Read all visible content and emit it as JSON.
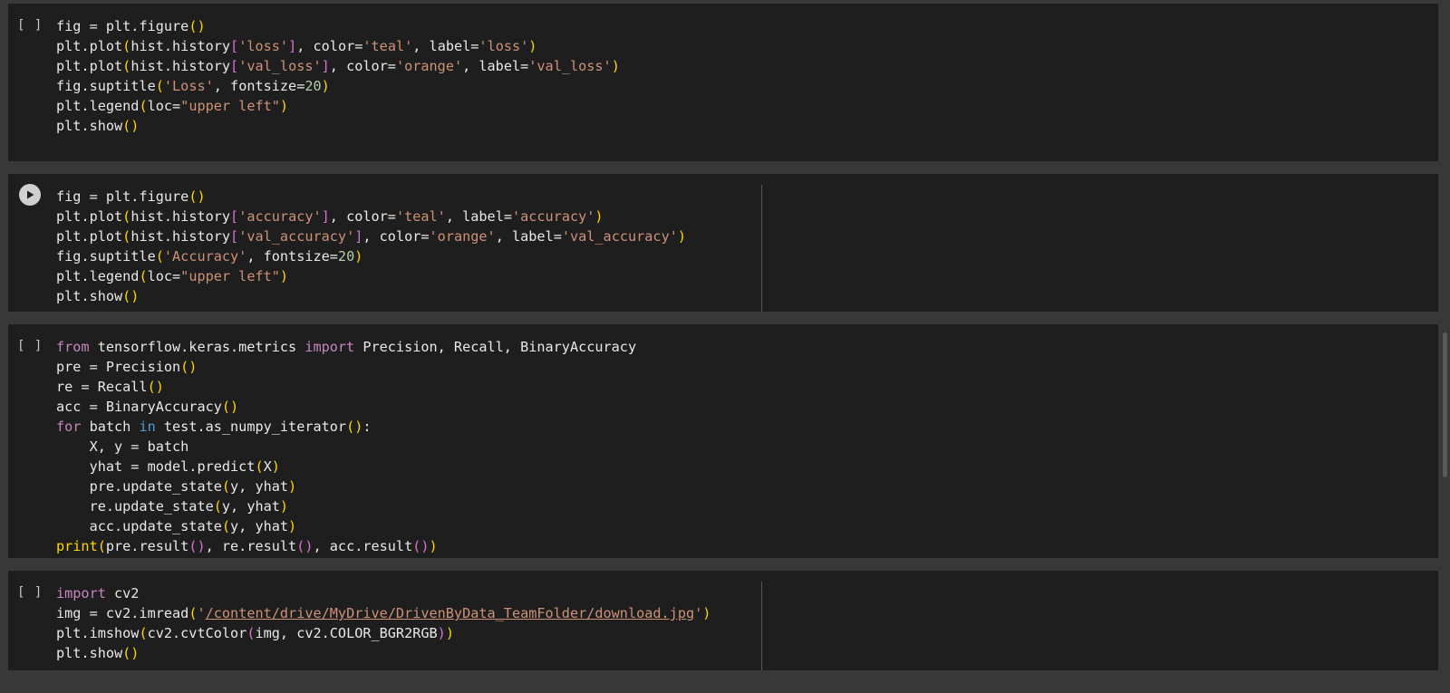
{
  "cells": [
    {
      "gutter": "[ ]",
      "lines": [
        [
          {
            "t": "fig = plt.figure"
          },
          {
            "t": "()",
            "c": "p"
          }
        ],
        [
          {
            "t": "plt.plot"
          },
          {
            "t": "(",
            "c": "p"
          },
          {
            "t": "hist.history"
          },
          {
            "t": "[",
            "c": "pp"
          },
          {
            "t": "'loss'",
            "c": "s"
          },
          {
            "t": "]",
            "c": "pp"
          },
          {
            "t": ", color="
          },
          {
            "t": "'teal'",
            "c": "s"
          },
          {
            "t": ", label="
          },
          {
            "t": "'loss'",
            "c": "s"
          },
          {
            "t": ")",
            "c": "p"
          }
        ],
        [
          {
            "t": "plt.plot"
          },
          {
            "t": "(",
            "c": "p"
          },
          {
            "t": "hist.history"
          },
          {
            "t": "[",
            "c": "pp"
          },
          {
            "t": "'val_loss'",
            "c": "s"
          },
          {
            "t": "]",
            "c": "pp"
          },
          {
            "t": ", color="
          },
          {
            "t": "'orange'",
            "c": "s"
          },
          {
            "t": ", label="
          },
          {
            "t": "'val_loss'",
            "c": "s"
          },
          {
            "t": ")",
            "c": "p"
          }
        ],
        [
          {
            "t": "fig.suptitle"
          },
          {
            "t": "(",
            "c": "p"
          },
          {
            "t": "'Loss'",
            "c": "s"
          },
          {
            "t": ", fontsize="
          },
          {
            "t": "20",
            "c": "n"
          },
          {
            "t": ")",
            "c": "p"
          }
        ],
        [
          {
            "t": "plt.legend"
          },
          {
            "t": "(",
            "c": "p"
          },
          {
            "t": "loc="
          },
          {
            "t": "\"upper left\"",
            "c": "s"
          },
          {
            "t": ")",
            "c": "p"
          }
        ],
        [
          {
            "t": "plt.show"
          },
          {
            "t": "()",
            "c": "p"
          }
        ]
      ]
    },
    {
      "gutter": "",
      "lines": [
        [
          {
            "t": "fig = plt.figure"
          },
          {
            "t": "()",
            "c": "p"
          }
        ],
        [
          {
            "t": "plt.plot"
          },
          {
            "t": "(",
            "c": "p"
          },
          {
            "t": "hist.history"
          },
          {
            "t": "[",
            "c": "pp"
          },
          {
            "t": "'accuracy'",
            "c": "s"
          },
          {
            "t": "]",
            "c": "pp"
          },
          {
            "t": ", color="
          },
          {
            "t": "'teal'",
            "c": "s"
          },
          {
            "t": ", label="
          },
          {
            "t": "'accuracy'",
            "c": "s"
          },
          {
            "t": ")",
            "c": "p"
          }
        ],
        [
          {
            "t": "plt.plot"
          },
          {
            "t": "(",
            "c": "p"
          },
          {
            "t": "hist.history"
          },
          {
            "t": "[",
            "c": "pp"
          },
          {
            "t": "'val_accuracy'",
            "c": "s"
          },
          {
            "t": "]",
            "c": "pp"
          },
          {
            "t": ", color="
          },
          {
            "t": "'orange'",
            "c": "s"
          },
          {
            "t": ", label="
          },
          {
            "t": "'val_accuracy'",
            "c": "s"
          },
          {
            "t": ")",
            "c": "p"
          }
        ],
        [
          {
            "t": "fig.suptitle"
          },
          {
            "t": "(",
            "c": "p"
          },
          {
            "t": "'Accuracy'",
            "c": "s"
          },
          {
            "t": ", fontsize="
          },
          {
            "t": "20",
            "c": "n"
          },
          {
            "t": ")",
            "c": "p"
          }
        ],
        [
          {
            "t": "plt.legend"
          },
          {
            "t": "(",
            "c": "p"
          },
          {
            "t": "loc="
          },
          {
            "t": "\"upper left\"",
            "c": "s"
          },
          {
            "t": ")",
            "c": "p"
          }
        ],
        [
          {
            "t": "plt.show"
          },
          {
            "t": "()",
            "c": "p"
          }
        ]
      ]
    },
    {
      "gutter": "[ ]",
      "lines": [
        [
          {
            "t": "from",
            "c": "k"
          },
          {
            "t": " tensorflow.keras.metrics "
          },
          {
            "t": "import",
            "c": "k"
          },
          {
            "t": " Precision, Recall, BinaryAccuracy"
          }
        ],
        [
          {
            "t": "pre = Precision"
          },
          {
            "t": "()",
            "c": "p"
          }
        ],
        [
          {
            "t": "re = Recall"
          },
          {
            "t": "()",
            "c": "p"
          }
        ],
        [
          {
            "t": "acc = BinaryAccuracy"
          },
          {
            "t": "()",
            "c": "p"
          }
        ],
        [
          {
            "t": "for",
            "c": "k"
          },
          {
            "t": " batch "
          },
          {
            "t": "in",
            "c": "kb"
          },
          {
            "t": " test.as_numpy_iterator"
          },
          {
            "t": "()",
            "c": "p"
          },
          {
            "t": ":"
          }
        ],
        [
          {
            "t": "    X, y = batch"
          }
        ],
        [
          {
            "t": "    yhat = model.predict"
          },
          {
            "t": "(",
            "c": "p"
          },
          {
            "t": "X"
          },
          {
            "t": ")",
            "c": "p"
          }
        ],
        [
          {
            "t": "    pre.update_state"
          },
          {
            "t": "(",
            "c": "p"
          },
          {
            "t": "y, yhat"
          },
          {
            "t": ")",
            "c": "p"
          }
        ],
        [
          {
            "t": "    re.update_state"
          },
          {
            "t": "(",
            "c": "p"
          },
          {
            "t": "y, yhat"
          },
          {
            "t": ")",
            "c": "p"
          }
        ],
        [
          {
            "t": "    acc.update_state"
          },
          {
            "t": "(",
            "c": "p"
          },
          {
            "t": "y, yhat"
          },
          {
            "t": ")",
            "c": "p"
          }
        ],
        [
          {
            "t": "print",
            "c": "p"
          },
          {
            "t": "(",
            "c": "p"
          },
          {
            "t": "pre.result"
          },
          {
            "t": "()",
            "c": "pp"
          },
          {
            "t": ", re.result"
          },
          {
            "t": "()",
            "c": "pp"
          },
          {
            "t": ", acc.result"
          },
          {
            "t": "()",
            "c": "pp"
          },
          {
            "t": ")",
            "c": "p"
          }
        ]
      ]
    },
    {
      "gutter": "[ ]",
      "lines": [
        [
          {
            "t": "import",
            "c": "k"
          },
          {
            "t": " cv2"
          }
        ],
        [
          {
            "t": "img = cv2.imread"
          },
          {
            "t": "(",
            "c": "p"
          },
          {
            "t": "'",
            "c": "s"
          },
          {
            "t": "/content/drive/MyDrive/DrivenByData_TeamFolder/download.jpg",
            "c": "s u"
          },
          {
            "t": "'",
            "c": "s"
          },
          {
            "t": ")",
            "c": "p"
          }
        ],
        [
          {
            "t": "plt.imshow"
          },
          {
            "t": "(",
            "c": "p"
          },
          {
            "t": "cv2.cvtColor"
          },
          {
            "t": "(",
            "c": "pp"
          },
          {
            "t": "img, cv2.COLOR_BGR2RGB"
          },
          {
            "t": ")",
            "c": "pp"
          },
          {
            "t": ")",
            "c": "p"
          }
        ],
        [
          {
            "t": "plt.show"
          },
          {
            "t": "()",
            "c": "p"
          }
        ]
      ]
    }
  ],
  "colors": {
    "background": "#383838",
    "cell_background": "#1e1e1e",
    "string": "#ce9178",
    "keyword": "#c586c0",
    "bracket_outer": "#ffd700",
    "bracket_inner": "#da70d6",
    "number": "#b5cea8"
  },
  "icons": {
    "run_cell": "play-circle-icon"
  }
}
